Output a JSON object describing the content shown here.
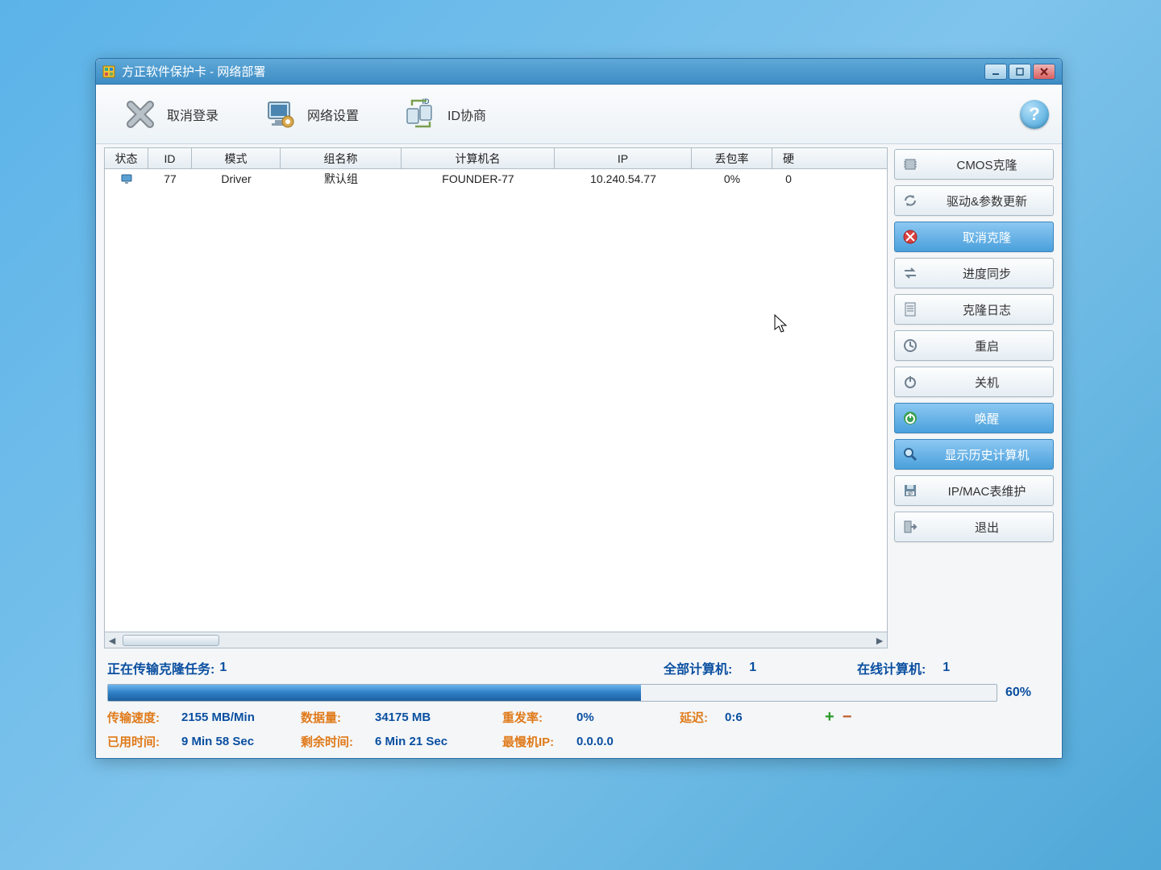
{
  "titlebar": {
    "title": "方正软件保护卡 - 网络部署"
  },
  "toolbar": {
    "cancel_login": "取消登录",
    "network_settings": "网络设置",
    "id_negotiate": "ID协商"
  },
  "table": {
    "headers": {
      "status": "状态",
      "id": "ID",
      "mode": "模式",
      "group": "组名称",
      "computer": "计算机名",
      "ip": "IP",
      "loss": "丢包率",
      "last": "硬"
    },
    "rows": [
      {
        "status_icon": "computer-icon",
        "id": "77",
        "mode": "Driver",
        "group": "默认组",
        "computer": "FOUNDER-77",
        "ip": "10.240.54.77",
        "loss": "0%",
        "last": "0"
      }
    ]
  },
  "actions": {
    "cmos_clone": "CMOS克隆",
    "driver_param_update": "驱动&参数更新",
    "cancel_clone": "取消克隆",
    "progress_sync": "进度同步",
    "clone_log": "克隆日志",
    "reboot": "重启",
    "shutdown": "关机",
    "wake": "唤醒",
    "show_history": "显示历史计算机",
    "ip_mac_maintain": "IP/MAC表维护",
    "exit": "退出"
  },
  "status": {
    "task_label": "正在传输克隆任务:",
    "task_count": "1",
    "all_label": "全部计算机:",
    "all_count": "1",
    "online_label": "在线计算机:",
    "online_count": "1",
    "progress_pct": 60,
    "progress_text": "60%",
    "stats": {
      "speed_label": "传输速度:",
      "speed_value": "2155 MB/Min",
      "data_label": "数据量:",
      "data_value": "34175 MB",
      "retry_label": "重发率:",
      "retry_value": "0%",
      "delay_label": "延迟:",
      "delay_value": "0:6",
      "elapsed_label": "已用时间:",
      "elapsed_value": "9 Min 58 Sec",
      "remain_label": "剩余时间:",
      "remain_value": "6 Min 21 Sec",
      "slowest_label": "最慢机IP:",
      "slowest_value": "0.0.0.0"
    }
  }
}
